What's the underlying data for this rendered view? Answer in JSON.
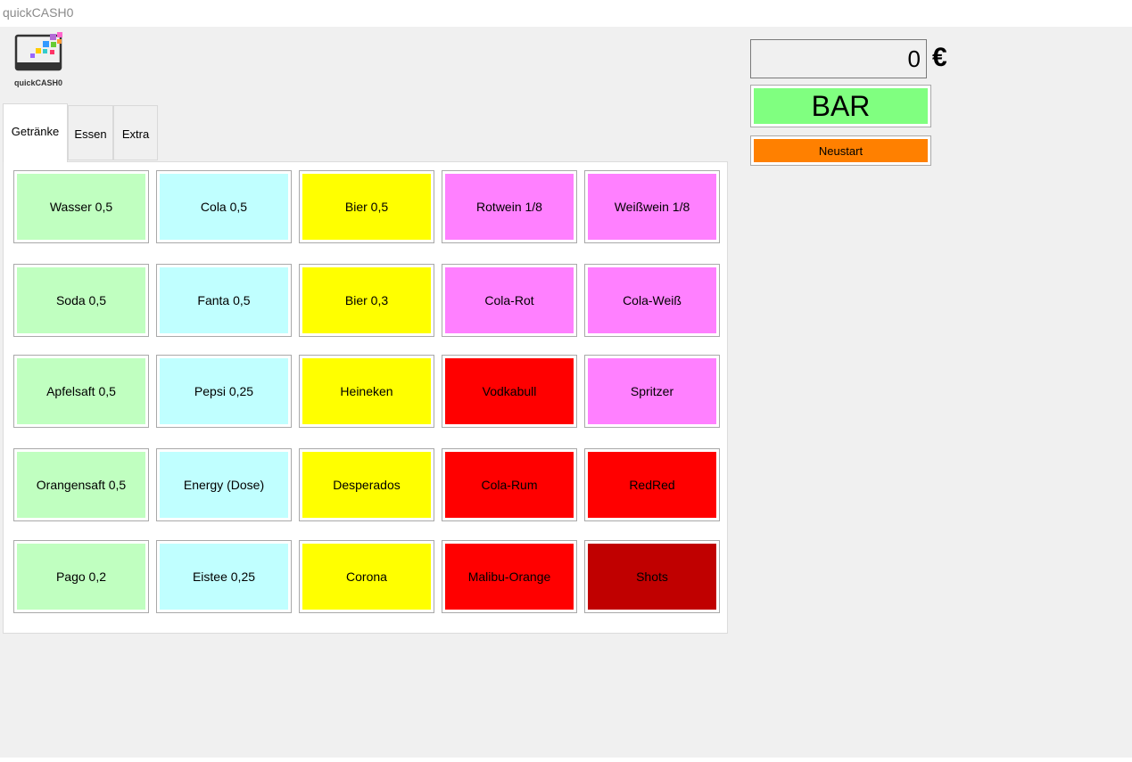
{
  "window": {
    "title": "quickCASH0"
  },
  "logo": {
    "text": "quickCASH0"
  },
  "tabs": [
    {
      "label": "Getränke",
      "active": true
    },
    {
      "label": "Essen",
      "active": false
    },
    {
      "label": "Extra",
      "active": false
    }
  ],
  "colors": {
    "green": "#c0ffc0",
    "cyan": "#c0ffff",
    "yellow": "#ffff00",
    "pink": "#ff80ff",
    "red": "#ff0000",
    "darkred": "#c00000",
    "bar": "#80ff80",
    "restart": "#ff8000"
  },
  "products": [
    [
      "Wasser 0,5",
      "Cola 0,5",
      "Bier 0,5",
      "Rotwein 1/8",
      "Weißwein 1/8"
    ],
    [
      "Soda 0,5",
      "Fanta 0,5",
      "Bier 0,3",
      "Cola-Rot",
      "Cola-Weiß"
    ],
    [
      "Apfelsaft 0,5",
      "Pepsi 0,25",
      "Heineken",
      "Vodkabull",
      "Spritzer"
    ],
    [
      "Orangensaft 0,5",
      "Energy (Dose)",
      "Desperados",
      "Cola-Rum",
      "RedRed"
    ],
    [
      "Pago 0,2",
      "Eistee 0,25",
      "Corona",
      "Malibu-Orange",
      "Shots"
    ]
  ],
  "product_colors": [
    [
      "green",
      "cyan",
      "yellow",
      "pink",
      "pink"
    ],
    [
      "green",
      "cyan",
      "yellow",
      "pink",
      "pink"
    ],
    [
      "green",
      "cyan",
      "yellow",
      "red",
      "pink"
    ],
    [
      "green",
      "cyan",
      "yellow",
      "red",
      "red"
    ],
    [
      "green",
      "cyan",
      "yellow",
      "red",
      "darkred"
    ]
  ],
  "total": {
    "value": "0",
    "currency": "€"
  },
  "actions": {
    "bar_label": "BAR",
    "restart_label": "Neustart"
  }
}
